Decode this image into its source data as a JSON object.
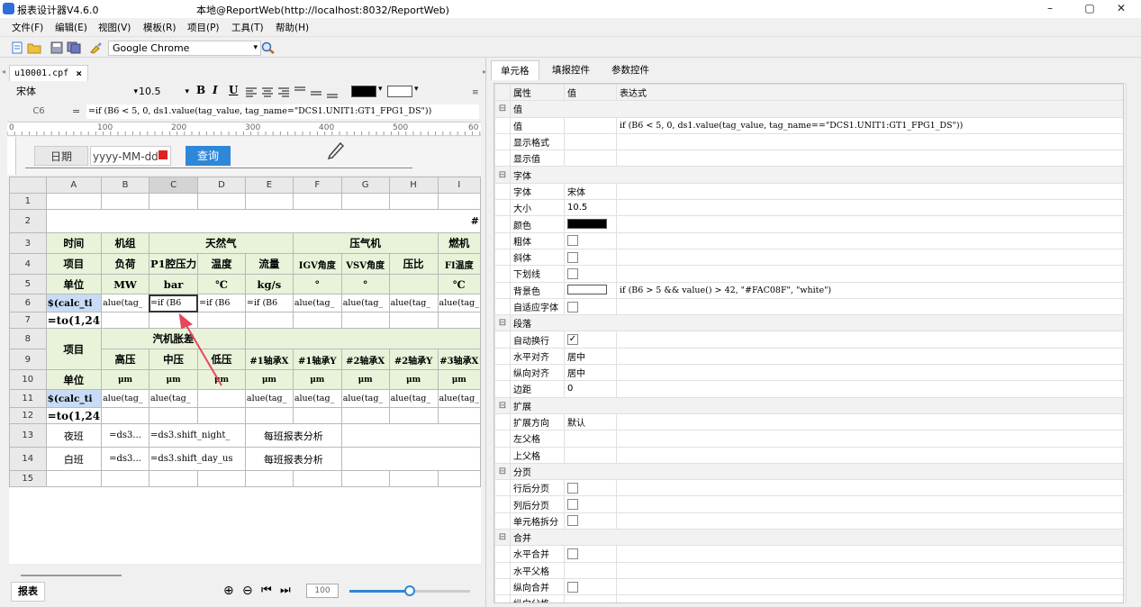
{
  "window": {
    "app_title": "报表设计器V4.6.0",
    "title": "本地@ReportWeb(http://localhost:8032/ReportWeb)",
    "min": "–",
    "max": "▢",
    "close": "✕"
  },
  "menu": [
    "文件(F)",
    "编辑(E)",
    "视图(V)",
    "模板(R)",
    "项目(P)",
    "工具(T)",
    "帮助(H)"
  ],
  "toolbar": {
    "browser": "Google Chrome"
  },
  "left": {
    "tab": "u10001.cpf",
    "tab_close": "×",
    "font": "宋体",
    "font_size": "10.5",
    "fmt_buttons": [
      "B",
      "I",
      "U"
    ],
    "cell_ref": "C6",
    "eq": "=",
    "formula": "=if (B6 < 5, 0, ds1.value(tag_value, tag_name=\"DCS1.UNIT1:GT1_FPG1_DS\"))",
    "ruler": [
      "0",
      "100",
      "200",
      "300",
      "400",
      "500",
      "60"
    ],
    "design": {
      "date_label": "日期",
      "date_value": "yyyy-MM-dd",
      "query": "查询"
    },
    "columns": [
      "A",
      "B",
      "C",
      "D",
      "E",
      "F",
      "G",
      "H",
      "I"
    ],
    "rows": [
      "1",
      "2",
      "3",
      "4",
      "5",
      "6",
      "7",
      "8",
      "9",
      "10",
      "11",
      "12",
      "13",
      "14",
      "15"
    ],
    "r2_end": "#",
    "r3": {
      "a": "时间",
      "b": "机组",
      "cde": "天然气",
      "fgh": "压气机",
      "i": "燃机"
    },
    "r4": {
      "a": "项目",
      "b": "负荷",
      "c": "P1腔压力",
      "d": "温度",
      "e": "流量",
      "f": "IGV角度",
      "g": "VSV角度",
      "h": "压比",
      "i": "FI温度"
    },
    "r5": {
      "a": "单位",
      "b": "MW",
      "c": "bar",
      "d": "℃",
      "e": "kg/s",
      "f": "°",
      "g": "°",
      "h": "",
      "i": "℃"
    },
    "r6": {
      "a": "$(calc_ti",
      "b": "alue(tag_",
      "c": "=if (B6",
      "d": "=if (B6",
      "e": "=if (B6",
      "f": "alue(tag_",
      "g": "alue(tag_",
      "h": "alue(tag_",
      "i": "alue(tag_"
    },
    "r7": {
      "a": "=to(1,24"
    },
    "r8": {
      "a": "项目",
      "bcd": "汽机胀差"
    },
    "r9": {
      "b": "高压",
      "c": "中压",
      "d": "低压",
      "e": "#1轴承X",
      "f": "#1轴承Y",
      "g": "#2轴承X",
      "h": "#2轴承Y",
      "i": "#3轴承X"
    },
    "r10": {
      "a": "单位",
      "b": "μm",
      "c": "μm",
      "d": "μm",
      "e": "μm",
      "f": "μm",
      "g": "μm",
      "h": "μm",
      "i": "μm"
    },
    "r11": {
      "a": "$(calc_ti",
      "b": "alue(tag_",
      "c": "alue(tag_",
      "d": "",
      "e": "alue(tag_",
      "f": "alue(tag_",
      "g": "alue(tag_",
      "h": "alue(tag_",
      "i": "alue(tag_"
    },
    "r12": {
      "a": "=to(1,24"
    },
    "r13": {
      "a": "夜班",
      "b": "=ds3...",
      "cd": "=ds3.shift_night_",
      "ef": "每班报表分析"
    },
    "r14": {
      "a": "白班",
      "b": "=ds3...",
      "cd": "=ds3.shift_day_us",
      "ef": "每班报表分析"
    },
    "sheet_tab": "报表",
    "zoom": "100"
  },
  "right": {
    "tabs": [
      "单元格",
      "填报控件",
      "参数控件"
    ],
    "headers": {
      "attr": "属性",
      "val": "值",
      "expr": "表达式"
    },
    "props": [
      {
        "cat": true,
        "name": "值"
      },
      {
        "name": "值",
        "val": "",
        "expr": "if (B6 < 5, 0, ds1.value(tag_value, tag_name==\"DCS1.UNIT1:GT1_FPG1_DS\"))"
      },
      {
        "name": "显示格式",
        "val": "",
        "expr": ""
      },
      {
        "name": "显示值",
        "val": "",
        "expr": ""
      },
      {
        "cat": true,
        "name": "字体"
      },
      {
        "name": "字体",
        "val": "宋体",
        "expr": ""
      },
      {
        "name": "大小",
        "val": "10.5",
        "expr": ""
      },
      {
        "name": "颜色",
        "val": "",
        "swatch": "#000000",
        "expr": ""
      },
      {
        "name": "粗体",
        "val": "",
        "check": false,
        "expr": ""
      },
      {
        "name": "斜体",
        "val": "",
        "check": false,
        "expr": ""
      },
      {
        "name": "下划线",
        "val": "",
        "check": false,
        "expr": ""
      },
      {
        "name": "背景色",
        "val": "",
        "swatch": "#ffffff",
        "expr": "if (B6 > 5 && value() > 42, \"#FAC08F\", \"white\")"
      },
      {
        "name": "自适应字体",
        "val": "",
        "check": false,
        "expr": ""
      },
      {
        "cat": true,
        "name": "段落"
      },
      {
        "name": "自动换行",
        "val": "",
        "check": true,
        "expr": ""
      },
      {
        "name": "水平对齐",
        "val": "居中",
        "expr": ""
      },
      {
        "name": "纵向对齐",
        "val": "居中",
        "expr": ""
      },
      {
        "name": "边距",
        "val": "0",
        "expr": ""
      },
      {
        "cat": true,
        "name": "扩展"
      },
      {
        "name": "扩展方向",
        "val": "默认",
        "expr": ""
      },
      {
        "name": "左父格",
        "val": "",
        "expr": ""
      },
      {
        "name": "上父格",
        "val": "",
        "expr": ""
      },
      {
        "cat": true,
        "name": "分页"
      },
      {
        "name": "行后分页",
        "val": "",
        "check": false,
        "expr": ""
      },
      {
        "name": "列后分页",
        "val": "",
        "check": false,
        "expr": ""
      },
      {
        "name": "单元格拆分",
        "val": "",
        "check": false,
        "expr": ""
      },
      {
        "cat": true,
        "name": "合并"
      },
      {
        "name": "水平合并",
        "val": "",
        "check": false,
        "expr": ""
      },
      {
        "name": "水平父格",
        "val": "",
        "expr": ""
      },
      {
        "name": "纵向合并",
        "val": "",
        "check": false,
        "expr": ""
      },
      {
        "name": "纵向父格",
        "val": "",
        "expr": ""
      }
    ]
  }
}
